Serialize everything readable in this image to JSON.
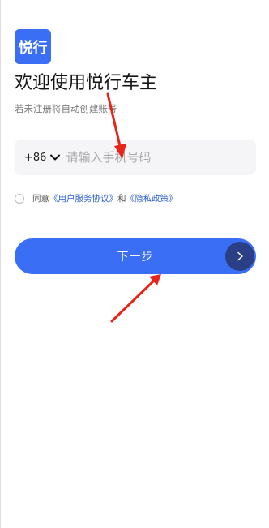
{
  "app": {
    "logo_text": "悦行",
    "welcome_title": "欢迎使用悦行车主",
    "subtitle": "若未注册将自动创建账号"
  },
  "login": {
    "country_code": "+86",
    "phone_placeholder": "请输入手机号码"
  },
  "agreement": {
    "prefix": "同意",
    "user_agreement": "《用户服务协议》",
    "conjunction": "和",
    "privacy_policy": "《隐私政策》",
    "checked": false
  },
  "actions": {
    "next_label": "下一步"
  },
  "icons": {
    "country_dropdown": "chevron-down-icon",
    "next_arrow": "chevron-right-icon"
  },
  "colors": {
    "brand_blue": "#3a6ff5",
    "dark_blue": "#2a3f86",
    "input_bg": "#f5f5f7",
    "link_blue": "#2f5fd6",
    "annotation_red": "#e8231a"
  }
}
